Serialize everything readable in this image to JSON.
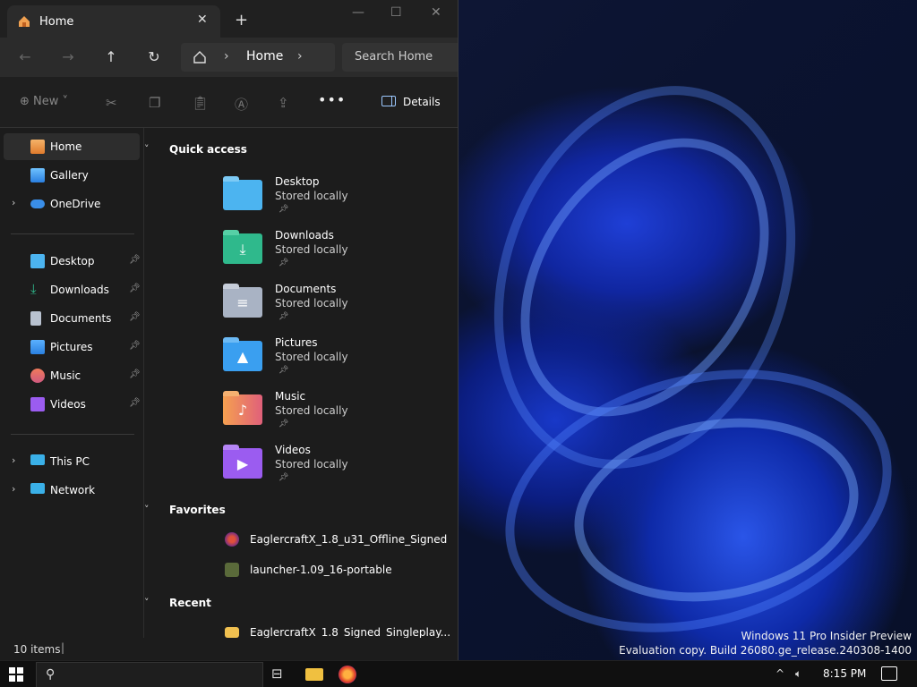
{
  "explorer": {
    "tab_title": "Home",
    "address": {
      "current": "Home",
      "search_placeholder": "Search Home"
    },
    "toolbar": {
      "new_label": "New",
      "details_label": "Details"
    },
    "sidebar": {
      "items": [
        {
          "label": "Home"
        },
        {
          "label": "Gallery"
        },
        {
          "label": "OneDrive"
        },
        {
          "label": "Desktop"
        },
        {
          "label": "Downloads"
        },
        {
          "label": "Documents"
        },
        {
          "label": "Pictures"
        },
        {
          "label": "Music"
        },
        {
          "label": "Videos"
        },
        {
          "label": "This PC"
        },
        {
          "label": "Network"
        }
      ]
    },
    "sections": {
      "quick_access": "Quick access",
      "favorites": "Favorites",
      "recent": "Recent"
    },
    "quick_access": [
      {
        "name": "Desktop",
        "sub": "Stored locally",
        "color": "#4cb4f0"
      },
      {
        "name": "Downloads",
        "sub": "Stored locally",
        "color": "#2fb98c"
      },
      {
        "name": "Documents",
        "sub": "Stored locally",
        "color": "#a9b3c4"
      },
      {
        "name": "Pictures",
        "sub": "Stored locally",
        "color": "#3a9ff0"
      },
      {
        "name": "Music",
        "sub": "Stored locally",
        "color": "#f08a5a"
      },
      {
        "name": "Videos",
        "sub": "Stored locally",
        "color": "#9b5cf0"
      }
    ],
    "favorites": [
      {
        "name": "EaglercraftX_1.8_u31_Offline_Signed"
      },
      {
        "name": "launcher-1.09_16-portable"
      }
    ],
    "recent": [
      {
        "name": "EaglercraftX_1.8_Signed_Singleplay..."
      }
    ],
    "status": {
      "count": "10 items"
    }
  },
  "desktop": {
    "watermark_line1": "Windows 11 Pro Insider Preview",
    "watermark_line2": "Evaluation copy. Build 26080.ge_release.240308-1400"
  },
  "taskbar": {
    "clock": "8:15 PM"
  },
  "colors": {
    "accent": "#4cc2ff",
    "window_bg": "#1c1c1c",
    "taskbar_bg": "#101010"
  }
}
